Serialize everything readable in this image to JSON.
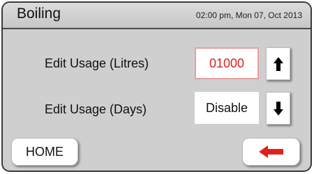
{
  "header": {
    "title": "Boiling",
    "datetime": "02:00 pm, Mon 07, Oct 2013"
  },
  "rows": [
    {
      "label": "Edit Usage (Litres)",
      "value": "01000",
      "value_color": "#e02020",
      "arrow": "arrow-up-icon"
    },
    {
      "label": "Edit Usage (Days)",
      "value": "Disable",
      "value_color": "#111111",
      "arrow": "arrow-down-icon"
    }
  ],
  "footer": {
    "home_label": "HOME",
    "back_icon": "arrow-left-icon",
    "back_icon_color": "#e02020"
  }
}
